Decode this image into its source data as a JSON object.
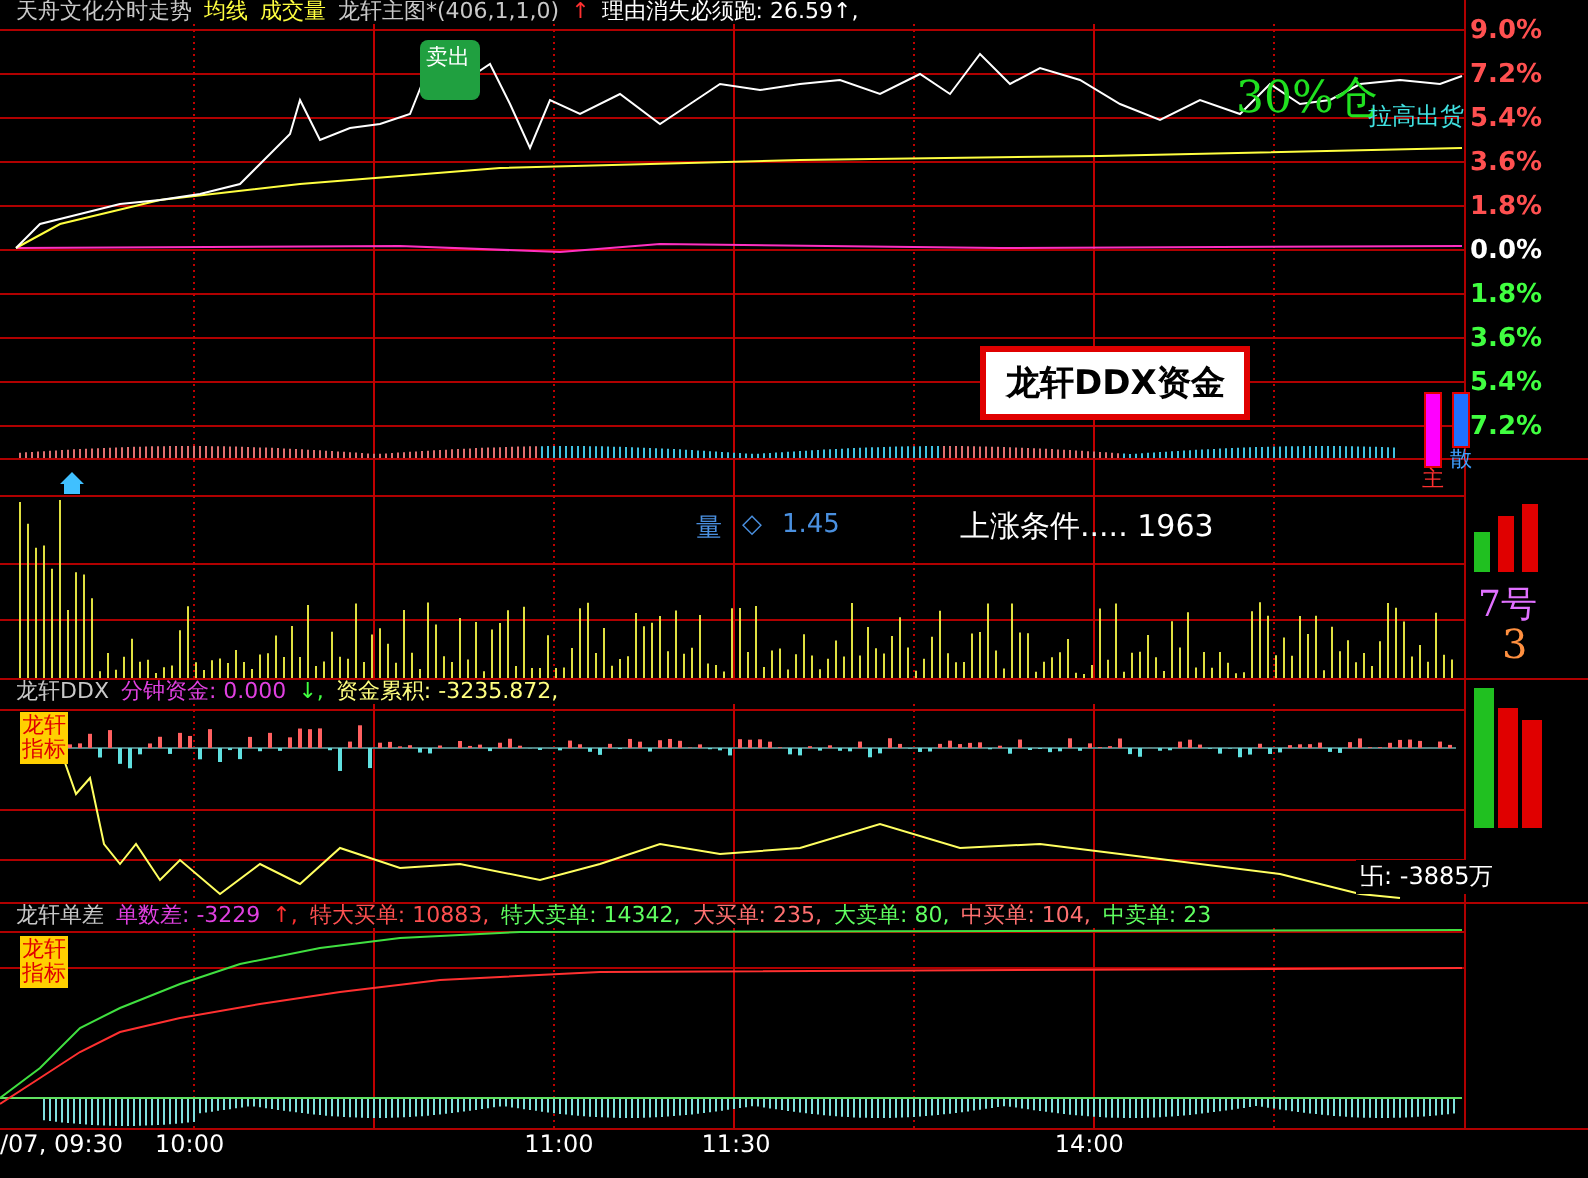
{
  "price_pane": {
    "header": [
      {
        "text": "天舟文化分时走势",
        "color": "#c8c8c8"
      },
      {
        "text": "均线",
        "color": "#ffff40"
      },
      {
        "text": "成交量",
        "color": "#ffff40"
      },
      {
        "text": "龙轩主图*(406,1,1,0)",
        "color": "#c8c8c8"
      },
      {
        "text": "↑",
        "color": "#ff3030"
      },
      {
        "text": "理由消失必须跑: 26.59↑,",
        "color": "#ffffff"
      }
    ],
    "signal_badge": "卖出",
    "position_note": "30%仓",
    "action_note": "拉高出货",
    "ddx_title": "龙轩DDX资金",
    "axis": [
      {
        "label": "9.0%",
        "kind": "up"
      },
      {
        "label": "7.2%",
        "kind": "up"
      },
      {
        "label": "5.4%",
        "kind": "up"
      },
      {
        "label": "3.6%",
        "kind": "up"
      },
      {
        "label": "1.8%",
        "kind": "up"
      },
      {
        "label": "0.0%",
        "kind": "zero"
      },
      {
        "label": "1.8%",
        "kind": "down"
      },
      {
        "label": "3.6%",
        "kind": "down"
      },
      {
        "label": "5.4%",
        "kind": "down"
      },
      {
        "label": "7.2%",
        "kind": "down"
      }
    ],
    "strength_bars": [
      {
        "label": "主",
        "color": "#ff00ff"
      },
      {
        "label": "散",
        "color": "#2070ff"
      }
    ]
  },
  "volume_pane": {
    "ratio_label": "量",
    "ratio_symbol": "◇",
    "ratio_value": "1.45",
    "rise_condition": "上涨条件..... 1963",
    "number_label": "7号",
    "number_value": "3"
  },
  "ddx_pane": {
    "header": [
      {
        "text": "龙轩DDX",
        "color": "#c8c8c8"
      },
      {
        "text": "分钟资金: 0.000",
        "color": "#e040e0"
      },
      {
        "text": "↓,",
        "color": "#40ff40"
      },
      {
        "text": "资金累积: -3235.872,",
        "color": "#ffff80"
      }
    ],
    "badge": "龙轩指标",
    "flow_total": "卐: -3885万"
  },
  "order_pane": {
    "header": [
      {
        "text": "龙轩单差",
        "color": "#c8c8c8"
      },
      {
        "text": "单数差: -3229",
        "color": "#e040e0"
      },
      {
        "text": "↑,",
        "color": "#ff3030"
      },
      {
        "text": "特大买单: 10883,",
        "color": "#ff5050"
      },
      {
        "text": "特大卖单: 14342,",
        "color": "#60ff60"
      },
      {
        "text": "大买单: 235,",
        "color": "#ff7070"
      },
      {
        "text": "大卖单: 80,",
        "color": "#60ff60"
      },
      {
        "text": "中买单: 104,",
        "color": "#ff7070"
      },
      {
        "text": "中卖单: 23",
        "color": "#60ff60"
      }
    ],
    "badge": "龙轩指标"
  },
  "time_axis": [
    "/07, 09:30",
    "10:00",
    "11:00",
    "11:30",
    "14:00"
  ]
}
